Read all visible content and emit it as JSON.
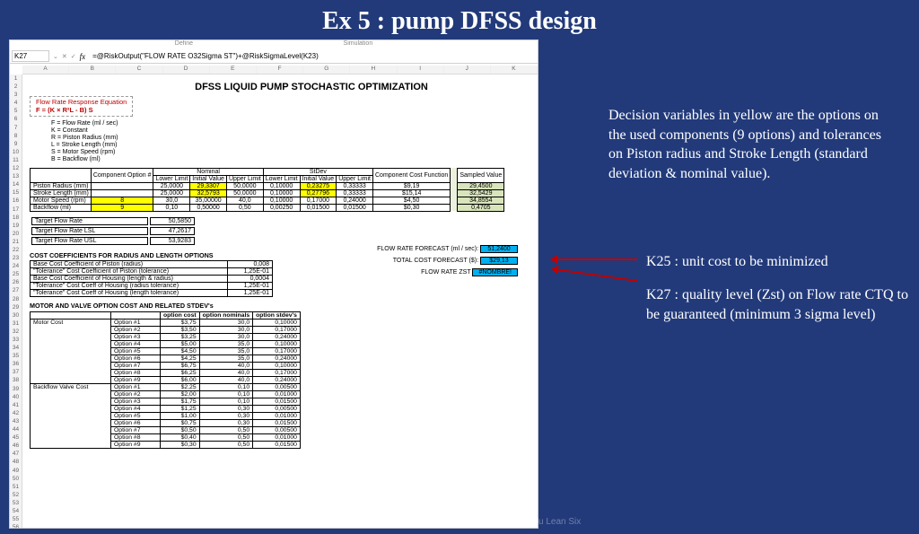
{
  "slide_title": "Ex 5 : pump DFSS design",
  "ribbon": {
    "a": "Define",
    "b": "Simulation"
  },
  "namebox": "K27",
  "formula": "=@RiskOutput(\"FLOW RATE O32Sigma ST\")+@RiskSigmaLevel(K23)",
  "sheet_title": "DFSS LIQUID PUMP STOCHASTIC OPTIMIZATION",
  "eq": {
    "l1": "Flow Rate Response Equation",
    "l2": "F = (K × R²L - B) S"
  },
  "defs": [
    "F = Flow Rate (ml / sec)",
    "K = Constant",
    "R = Piston Radius (mm)",
    "L = Stroke Length (mm)",
    "S = Motor Speed (rpm)",
    "B = Backflow (ml)"
  ],
  "main": {
    "groups": [
      "",
      "Nominal",
      "StDev",
      "",
      ""
    ],
    "headers": [
      "",
      "Component Option #",
      "Lower Limit",
      "Initial Value",
      "Upper Limit",
      "Lower Limit",
      "Initial Value",
      "Upper Limit",
      "Component Cost Function",
      "Sampled Value"
    ],
    "rows": [
      {
        "n": "Piston Radius (mm)",
        "opt": "",
        "ll": "25,0000",
        "iv": "29,3307",
        "ul": "50,0000",
        "sll": "0,10000",
        "siv": "0,23275",
        "sul": "0,33333",
        "cost": "$9,19",
        "sv": "29,4500",
        "ylw": [
          "iv",
          "siv"
        ]
      },
      {
        "n": "Stroke Length (mm)",
        "opt": "",
        "ll": "25,0000",
        "iv": "32,5793",
        "ul": "50,0000",
        "sll": "0,10000",
        "siv": "0,27796",
        "sul": "0,33333",
        "cost": "$15,14",
        "sv": "32,5429",
        "ylw": [
          "iv",
          "siv"
        ]
      },
      {
        "n": "Motor Speed (rpm)",
        "opt": "8",
        "ll": "30,0",
        "iv": "35,00000",
        "ul": "40,0",
        "sll": "0,10000",
        "siv": "0,17000",
        "sul": "0,24000",
        "cost": "$4,50",
        "sv": "34,8554",
        "ylw": [
          "opt"
        ]
      },
      {
        "n": "Backflow (ml)",
        "opt": "9",
        "ll": "0,10",
        "iv": "0,50000",
        "ul": "0,50",
        "sll": "0,00250",
        "siv": "0,01500",
        "sul": "0,01500",
        "cost": "$0,30",
        "sv": "0,4705",
        "ylw": [
          "opt"
        ]
      }
    ]
  },
  "targets": [
    {
      "n": "Target Flow Rate",
      "v": "50,5850"
    },
    {
      "n": "Target Flow Rate LSL",
      "v": "47,2617"
    },
    {
      "n": "Target Flow Rate USL",
      "v": "53,9283"
    }
  ],
  "outputs": [
    {
      "label": "FLOW RATE FORECAST (ml / sec):",
      "val": "51,2400"
    },
    {
      "label": "TOTAL COST FORECAST ($):",
      "val": "$29,13"
    },
    {
      "label": "FLOW RATE ZST",
      "val": "#NOMBRE!"
    }
  ],
  "coef_title": "COST COEFFICIENTS FOR RADIUS AND LENGTH OPTIONS",
  "coefs": [
    {
      "n": "Base Cost Coefficient of Piston (radius)",
      "v": "0,008"
    },
    {
      "n": "\"Tolerance\" Cost Coefficient of Piston (tolerance)",
      "v": "1,25E-01"
    },
    {
      "n": "Base Cost Coefficient of Housing (length & radius)",
      "v": "0,0004"
    },
    {
      "n": "\"Tolerance\" Cost Coeff of Housing (radius tolerance)",
      "v": "1,25E-01"
    },
    {
      "n": "\"Tolerance\" Cost Coeff of Housing (length tolerance)",
      "v": "1,25E-01"
    }
  ],
  "opts_title": "MOTOR AND VALVE OPTION COST AND RELATED STDEV's",
  "opts_head": [
    "",
    "",
    "option cost",
    "option nominals",
    "option stdev's"
  ],
  "motor": {
    "label": "Motor Cost",
    "rows": [
      [
        "Option #1",
        "$3,75",
        "30,0",
        "0,10000"
      ],
      [
        "Option #2",
        "$3,50",
        "30,0",
        "0,17000"
      ],
      [
        "Option #3",
        "$3,25",
        "30,0",
        "0,24000"
      ],
      [
        "Option #4",
        "$5,00",
        "35,0",
        "0,10000"
      ],
      [
        "Option #5",
        "$4,50",
        "35,0",
        "0,17000"
      ],
      [
        "Option #6",
        "$4,25",
        "35,0",
        "0,24000"
      ],
      [
        "Option #7",
        "$6,75",
        "40,0",
        "0,10000"
      ],
      [
        "Option #8",
        "$6,25",
        "40,0",
        "0,17000"
      ],
      [
        "Option #9",
        "$6,00",
        "40,0",
        "0,24000"
      ]
    ]
  },
  "backflow": {
    "label": "Backflow Valve Cost",
    "rows": [
      [
        "Option #1",
        "$2,25",
        "0,10",
        "0,00500"
      ],
      [
        "Option #2",
        "$2,00",
        "0,10",
        "0,01000"
      ],
      [
        "Option #3",
        "$1,75",
        "0,10",
        "0,01500"
      ],
      [
        "Option #4",
        "$1,25",
        "0,30",
        "0,00500"
      ],
      [
        "Option #5",
        "$1,00",
        "0,30",
        "0,01000"
      ],
      [
        "Option #6",
        "$0,75",
        "0,30",
        "0,01500"
      ],
      [
        "Option #7",
        "$0,50",
        "0,50",
        "0,00500"
      ],
      [
        "Option #8",
        "$0,40",
        "0,50",
        "0,01000"
      ],
      [
        "Option #9",
        "$0,30",
        "0,50",
        "0,01500"
      ]
    ]
  },
  "annot1": "Decision variables in yellow are the options on the used components (9 options) and tolerances on Piston radius and Stroke Length (standard deviation & nominal value).",
  "annot2": "K25 : unit cost to be minimized",
  "annot3": "K27 : quality level (Zst) on Flow rate CTQ to be guaranteed (minimum 3 sigma level)",
  "footer": "service du Lean Six"
}
